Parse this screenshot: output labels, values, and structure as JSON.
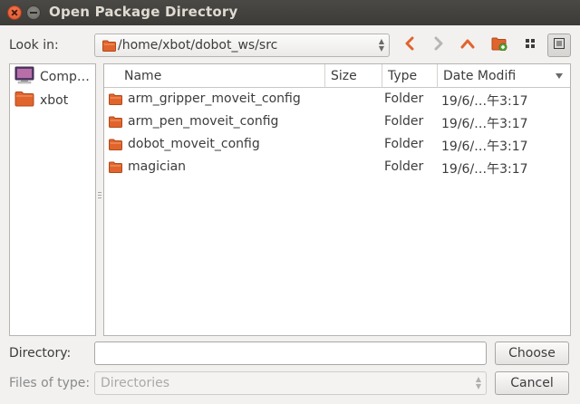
{
  "window": {
    "title": "Open Package Directory"
  },
  "toolbar": {
    "lookin_label": "Look in:",
    "path": "/home/xbot/dobot_ws/src",
    "buttons": [
      "back-arrow-icon",
      "forward-arrow-icon",
      "up-arrow-icon",
      "new-folder-icon",
      "icon-view-icon",
      "list-view-icon"
    ]
  },
  "sidebar": {
    "items": [
      {
        "label": "Comp…",
        "icon": "computer-icon"
      },
      {
        "label": "xbot",
        "icon": "home-folder-icon"
      }
    ]
  },
  "filelist": {
    "columns": [
      "Name",
      "Size",
      "Type",
      "Date Modifi"
    ],
    "sort_column": "Date Modifi",
    "rows": [
      {
        "name": "arm_gripper_moveit_config",
        "size": "",
        "type": "Folder",
        "date": "19/6/…午3:17"
      },
      {
        "name": "arm_pen_moveit_config",
        "size": "",
        "type": "Folder",
        "date": "19/6/…午3:17"
      },
      {
        "name": "dobot_moveit_config",
        "size": "",
        "type": "Folder",
        "date": "19/6/…午3:17"
      },
      {
        "name": "magician",
        "size": "",
        "type": "Folder",
        "date": "19/6/…午3:17"
      }
    ]
  },
  "bottom": {
    "directory_label": "Directory:",
    "directory_value": "",
    "files_of_type_label": "Files of type:",
    "files_of_type_value": "Directories",
    "choose_label": "Choose",
    "cancel_label": "Cancel"
  },
  "colors": {
    "folder": "#e0642c",
    "titlebar": "#3c3b37",
    "accent": "#e0542b"
  }
}
